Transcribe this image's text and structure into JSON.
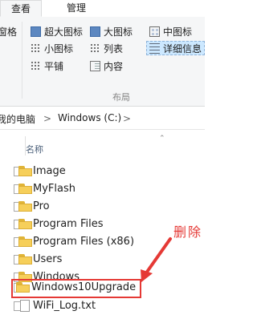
{
  "tabs": [
    {
      "label": "查看",
      "active": true
    },
    {
      "label": "管理",
      "active": false
    }
  ],
  "ribbon": {
    "left_fragment": "窗格",
    "layout_group_label": "布局",
    "layout_options": [
      {
        "label": "超大图标",
        "icon": "extra-large-icons-icon"
      },
      {
        "label": "大图标",
        "icon": "large-icons-icon"
      },
      {
        "label": "中图标",
        "icon": "medium-icons-icon"
      },
      {
        "label": "小图标",
        "icon": "small-icons-icon"
      },
      {
        "label": "列表",
        "icon": "list-view-icon"
      },
      {
        "label": "详细信息",
        "icon": "details-view-icon",
        "selected": true
      },
      {
        "label": "平铺",
        "icon": "tiles-view-icon"
      },
      {
        "label": "内容",
        "icon": "content-view-icon"
      }
    ]
  },
  "address_bar": {
    "crumbs": [
      "我的电脑",
      "Windows (C:)"
    ]
  },
  "column_header": {
    "name": "名称"
  },
  "files": [
    {
      "name": "Image",
      "type": "folder"
    },
    {
      "name": "MyFlash",
      "type": "folder"
    },
    {
      "name": "Pro",
      "type": "folder"
    },
    {
      "name": "Program Files",
      "type": "folder"
    },
    {
      "name": "Program Files (x86)",
      "type": "folder"
    },
    {
      "name": "Users",
      "type": "folder"
    },
    {
      "name": "Windows",
      "type": "folder"
    },
    {
      "name": "Windows10Upgrade",
      "type": "folder",
      "highlighted": true
    },
    {
      "name": "WiFi_Log.txt",
      "type": "file"
    }
  ],
  "annotation": {
    "text": "删除",
    "color": "#e53935"
  },
  "colors": {
    "ribbon_bg": "#f5f6f7",
    "selected_bg": "#cce8ff",
    "folder_yellow": "#f6cf5a",
    "highlight_red": "#e53935"
  }
}
